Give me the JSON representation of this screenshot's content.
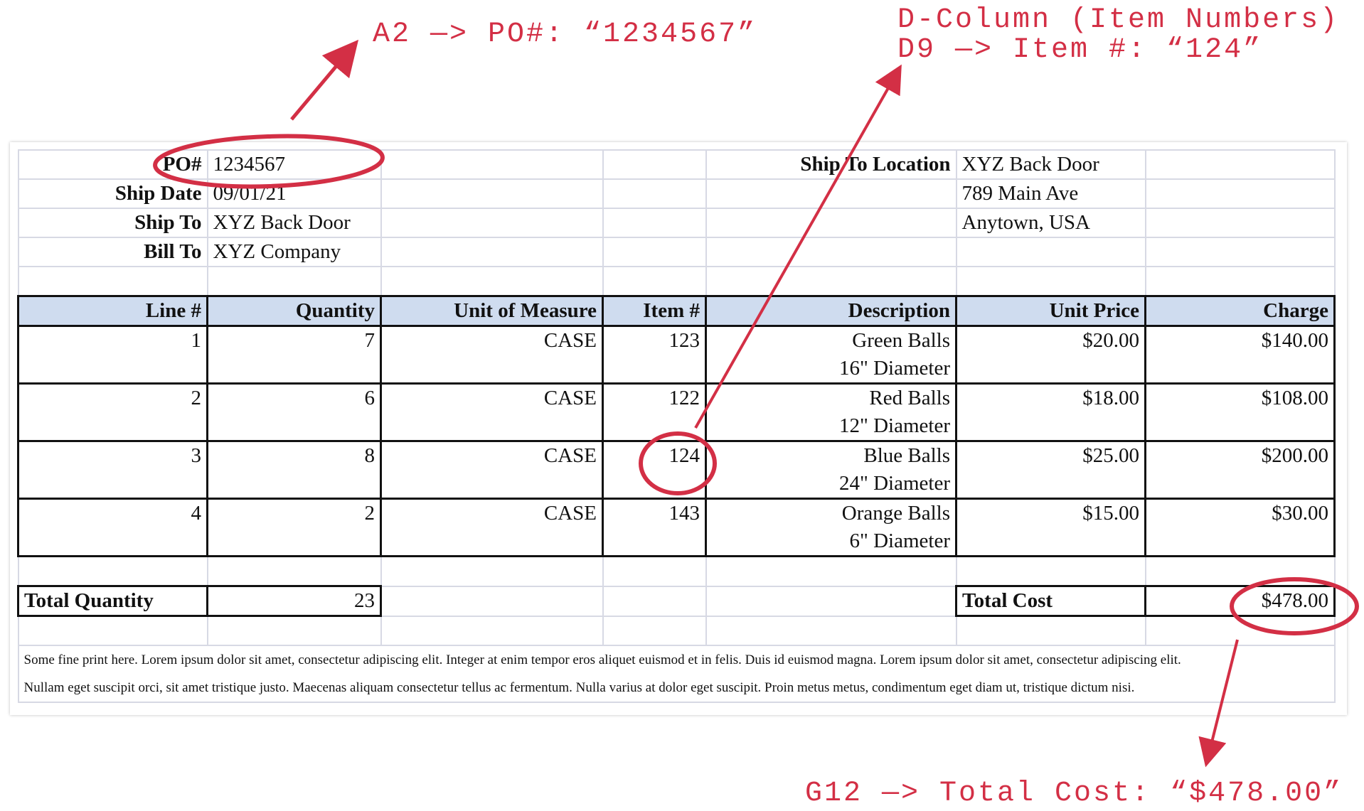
{
  "header": {
    "po_label": "PO#",
    "po_value": "1234567",
    "ship_date_label": "Ship Date",
    "ship_date_value": "09/01/21",
    "ship_to_label": "Ship To",
    "ship_to_value": "XYZ Back Door",
    "bill_to_label": "Bill To",
    "bill_to_value": "XYZ Company",
    "ship_to_location_label": "Ship To Location",
    "location_line1": "XYZ Back Door",
    "location_line2": "789 Main Ave",
    "location_line3": "Anytown, USA"
  },
  "columns": [
    "Line #",
    "Quantity",
    "Unit of Measure",
    "Item #",
    "Description",
    "Unit Price",
    "Charge"
  ],
  "items": [
    {
      "line": "1",
      "qty": "7",
      "uom": "CASE",
      "item": "123",
      "desc1": "Green Balls",
      "desc2": "16\" Diameter",
      "price": "$20.00",
      "charge": "$140.00"
    },
    {
      "line": "2",
      "qty": "6",
      "uom": "CASE",
      "item": "122",
      "desc1": "Red Balls",
      "desc2": "12\" Diameter",
      "price": "$18.00",
      "charge": "$108.00"
    },
    {
      "line": "3",
      "qty": "8",
      "uom": "CASE",
      "item": "124",
      "desc1": "Blue Balls",
      "desc2": "24\" Diameter",
      "price": "$25.00",
      "charge": "$200.00"
    },
    {
      "line": "4",
      "qty": "2",
      "uom": "CASE",
      "item": "143",
      "desc1": "Orange Balls",
      "desc2": "6\" Diameter",
      "price": "$15.00",
      "charge": "$30.00"
    }
  ],
  "totals": {
    "qty_label": "Total Quantity",
    "qty_value": "23",
    "cost_label": "Total Cost",
    "cost_value": "$478.00"
  },
  "fine_print": {
    "line1": "Some fine print here. Lorem ipsum dolor sit amet, consectetur adipiscing elit. Integer at enim tempor eros aliquet euismod et in felis. Duis id euismod magna. Lorem ipsum dolor sit amet, consectetur adipiscing elit.",
    "line2": "Nullam eget suscipit orci, sit amet tristique justo. Maecenas aliquam consectetur tellus ac fermentum. Nulla varius at dolor eget suscipit. Proin metus metus, condimentum eget diam ut, tristique dictum nisi."
  },
  "annotations": {
    "po": "A2 —> PO#: “1234567”",
    "item_title": "D-Column (Item Numbers)",
    "item": "D9 —> Item #: “124”",
    "cost": "G12 —> Total Cost: “$478.00”",
    "color": "#d32f45"
  }
}
